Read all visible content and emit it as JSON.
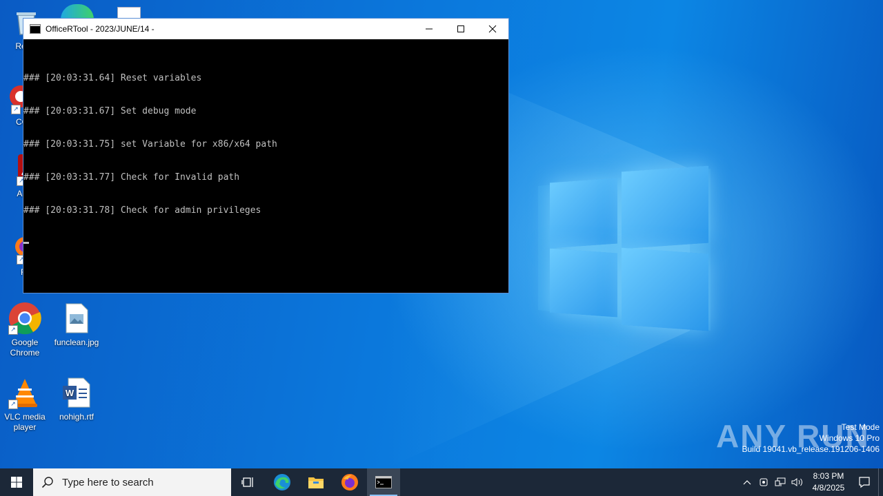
{
  "console": {
    "title": "OfficeRTool - 2023/JUNE/14 -",
    "lines": [
      "### [20:03:31.64] Reset variables",
      "### [20:03:31.67] Set debug mode",
      "### [20:03:31.75] set Variable for x86/x64 path",
      "### [20:03:31.77] Check for Invalid path",
      "### [20:03:31.78] Check for admin privileges"
    ]
  },
  "desktop_icons": [
    {
      "label": "Recy",
      "icon": "recycle-bin-icon"
    },
    {
      "label": "CCl",
      "icon": "ccleaner-icon"
    },
    {
      "label": "Ad Acr",
      "icon": "acrobat-icon"
    },
    {
      "label": "Fir",
      "icon": "firefox-icon"
    },
    {
      "label": "Google Chrome",
      "icon": "chrome-icon"
    },
    {
      "label": "funclean.jpg",
      "icon": "image-file-icon"
    },
    {
      "label": "VLC media player",
      "icon": "vlc-icon"
    },
    {
      "label": "nohigh.rtf",
      "icon": "word-document-icon"
    }
  ],
  "watermark": {
    "brand": "ANY RUN",
    "line1": "Test Mode",
    "line2": "Windows 10 Pro",
    "line3": "Build 19041.vb_release.191206-1406"
  },
  "taskbar": {
    "search_placeholder": "Type here to search",
    "time": "8:03 PM",
    "date": "4/8/2025"
  },
  "colors": {
    "accent": "#0a6fd1",
    "taskbar": "#1c2838",
    "console_bg": "#000000",
    "console_text": "#c0c0c0"
  }
}
